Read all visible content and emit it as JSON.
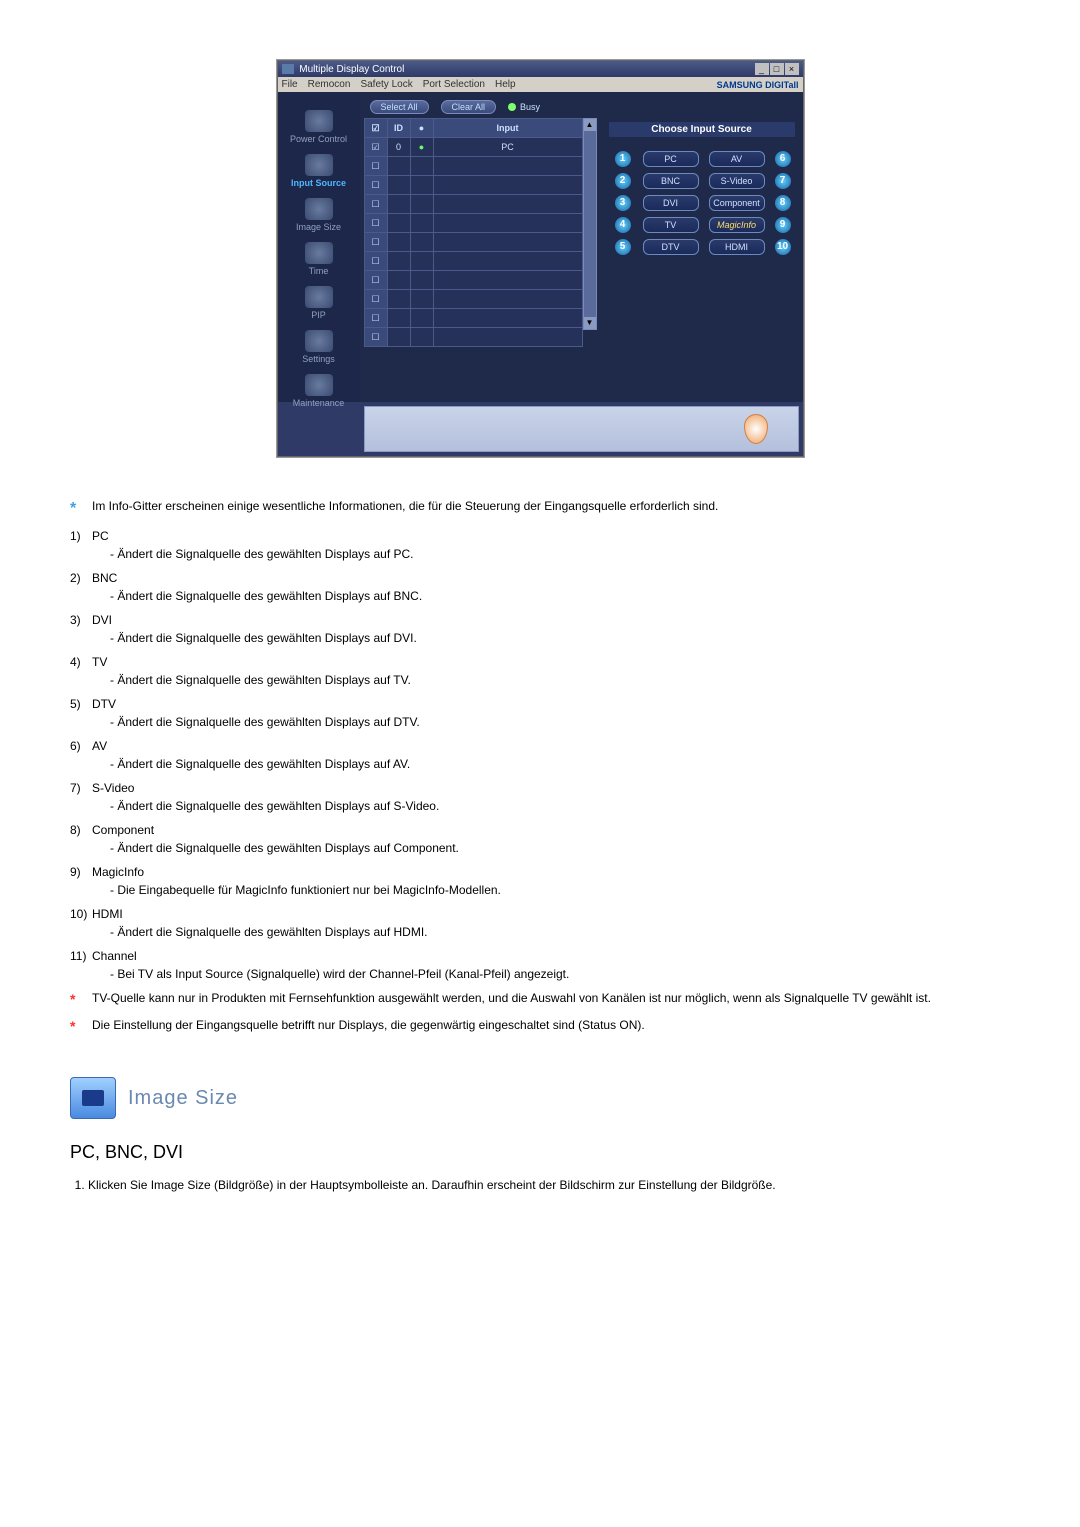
{
  "app": {
    "title": "Multiple Display Control",
    "menubar": [
      "File",
      "Remocon",
      "Safety Lock",
      "Port Selection",
      "Help"
    ],
    "brand": "SAMSUNG DIGITall"
  },
  "sidebar": {
    "items": [
      {
        "label": "Power Control"
      },
      {
        "label": "Input Source",
        "active": true
      },
      {
        "label": "Image Size"
      },
      {
        "label": "Time"
      },
      {
        "label": "PIP"
      },
      {
        "label": "Settings"
      },
      {
        "label": "Maintenance"
      }
    ]
  },
  "toolbar": {
    "select_all": "Select All",
    "clear_all": "Clear All",
    "busy": "Busy"
  },
  "grid": {
    "headers": {
      "id": "ID",
      "input": "Input"
    },
    "first_row": {
      "id": "0",
      "input": "PC"
    }
  },
  "panel": {
    "header": "Choose Input Source",
    "rows": [
      {
        "n1": "1",
        "b1": "PC",
        "b2": "AV",
        "n2": "6"
      },
      {
        "n1": "2",
        "b1": "BNC",
        "b2": "S-Video",
        "n2": "7"
      },
      {
        "n1": "3",
        "b1": "DVI",
        "b2": "Component",
        "n2": "8"
      },
      {
        "n1": "4",
        "b1": "TV",
        "b2": "MagicInfo",
        "n2": "9"
      },
      {
        "n1": "5",
        "b1": "DTV",
        "b2": "HDMI",
        "n2": "10"
      }
    ]
  },
  "note_intro": "Im Info-Gitter erscheinen einige wesentliche Informationen, die für die Steuerung der Eingangsquelle erforderlich sind.",
  "items": [
    {
      "n": "1)",
      "title": "PC",
      "desc": "- Ändert die Signalquelle des gewählten Displays auf PC."
    },
    {
      "n": "2)",
      "title": "BNC",
      "desc": "- Ändert die Signalquelle des gewählten Displays auf BNC."
    },
    {
      "n": "3)",
      "title": "DVI",
      "desc": "- Ändert die Signalquelle des gewählten Displays auf DVI."
    },
    {
      "n": "4)",
      "title": "TV",
      "desc": "- Ändert die Signalquelle des gewählten Displays auf TV."
    },
    {
      "n": "5)",
      "title": "DTV",
      "desc": "- Ändert die Signalquelle des gewählten Displays auf DTV."
    },
    {
      "n": "6)",
      "title": "AV",
      "desc": "- Ändert die Signalquelle des gewählten Displays auf AV."
    },
    {
      "n": "7)",
      "title": "S-Video",
      "desc": "- Ändert die Signalquelle des gewählten Displays auf S-Video."
    },
    {
      "n": "8)",
      "title": "Component",
      "desc": "- Ändert die Signalquelle des gewählten Displays auf Component."
    },
    {
      "n": "9)",
      "title": "MagicInfo",
      "desc": "- Die Eingabequelle für MagicInfo funktioniert nur bei MagicInfo-Modellen."
    },
    {
      "n": "10)",
      "title": "HDMI",
      "desc": "- Ändert die Signalquelle des gewählten Displays auf HDMI."
    },
    {
      "n": "11)",
      "title": "Channel",
      "desc": "- Bei TV als Input Source (Signalquelle) wird der Channel-Pfeil (Kanal-Pfeil) angezeigt."
    }
  ],
  "footnotes": [
    "TV-Quelle kann nur in Produkten mit Fernsehfunktion ausgewählt werden, und die Auswahl von Kanälen ist nur möglich, wenn als Signalquelle TV gewählt ist.",
    "Die Einstellung der Eingangsquelle betrifft nur Displays, die gegenwärtig eingeschaltet sind (Status ON)."
  ],
  "section": {
    "title": "Image Size",
    "subtitle": "PC, BNC, DVI",
    "step1": "Klicken Sie Image Size (Bildgröße) in der Hauptsymbolleiste an. Daraufhin erscheint der Bildschirm zur Einstellung der Bildgröße."
  }
}
